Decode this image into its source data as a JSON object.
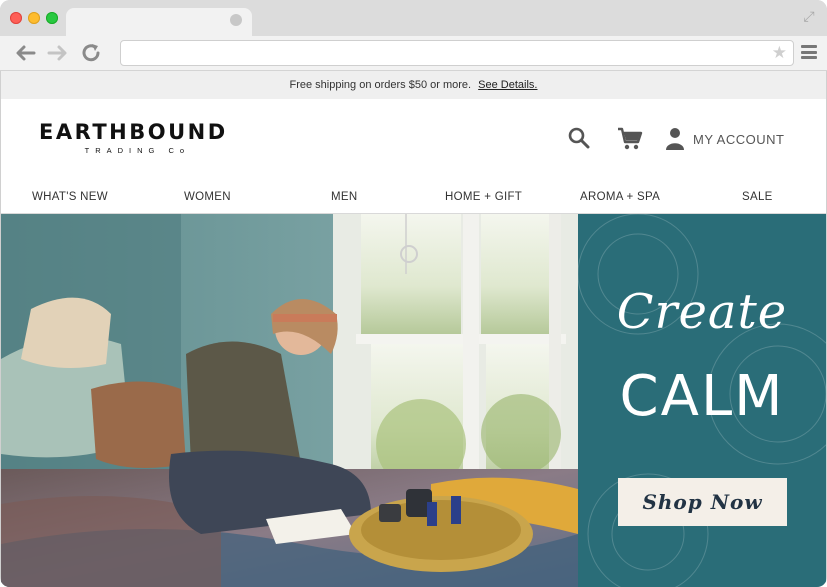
{
  "browser": {
    "url": "",
    "icons": {
      "back": "arrow-left-icon",
      "forward": "arrow-right-icon",
      "reload": "reload-icon",
      "bookmark": "star-icon",
      "menu": "hamburger-menu-icon",
      "fullscreen": "fullscreen-icon"
    }
  },
  "promo": {
    "text": "Free shipping on orders $50 or more.",
    "link": "See Details."
  },
  "header": {
    "logo_main": "EARTHBOUND",
    "logo_sub": "TRADING Co",
    "account_label": "MY ACCOUNT",
    "icons": {
      "search": "search-icon",
      "cart": "cart-icon",
      "account": "user-icon"
    }
  },
  "nav": {
    "items": [
      "WHAT'S NEW",
      "WOMEN",
      "MEN",
      "HOME + GIFT",
      "AROMA + SPA",
      "SALE"
    ]
  },
  "hero": {
    "title_script": "Create",
    "title_main": "CALM",
    "cta_label": "Shop Now"
  },
  "colors": {
    "hero_panel": "#2a6d78",
    "cta_background": "#f4efe8",
    "promo_bar": "#efefef"
  }
}
